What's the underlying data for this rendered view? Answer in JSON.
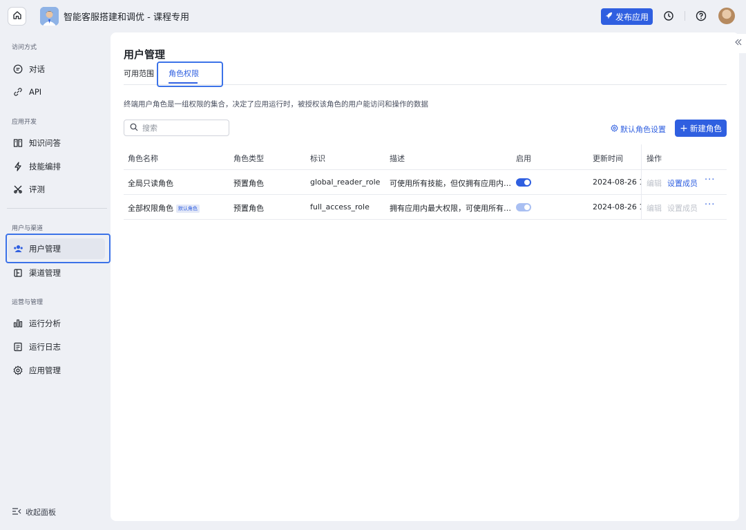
{
  "header": {
    "app_title": "智能客服搭建和调优 - 课程专用",
    "publish_label": "发布应用"
  },
  "sidebar": {
    "groups": [
      {
        "label": "访问方式",
        "items": [
          {
            "label": "对话",
            "icon": "chat-icon"
          },
          {
            "label": "API",
            "icon": "api-icon"
          }
        ]
      },
      {
        "label": "应用开发",
        "items": [
          {
            "label": "知识问答",
            "icon": "book-icon"
          },
          {
            "label": "技能编排",
            "icon": "lightning-icon"
          },
          {
            "label": "评测",
            "icon": "evaluate-icon"
          }
        ]
      },
      {
        "label": "用户与渠道",
        "items": [
          {
            "label": "用户管理",
            "icon": "users-icon"
          },
          {
            "label": "渠道管理",
            "icon": "channel-icon"
          }
        ]
      },
      {
        "label": "运营与管理",
        "items": [
          {
            "label": "运行分析",
            "icon": "bar-chart-icon"
          },
          {
            "label": "运行日志",
            "icon": "log-icon"
          },
          {
            "label": "应用管理",
            "icon": "settings-icon"
          }
        ]
      }
    ],
    "collapse_label": "收起面板"
  },
  "main": {
    "title": "用户管理",
    "tabs": [
      "可用范围",
      "角色权限"
    ],
    "description": "终端用户角色是一组权限的集合，决定了应用运行时，被授权该角色的用户能访问和操作的数据",
    "search_placeholder": "搜索",
    "default_role_label": "默认角色设置",
    "new_role_label": "新建角色",
    "table": {
      "headers": [
        "角色名称",
        "角色类型",
        "标识",
        "描述",
        "启用",
        "更新时间",
        "操作"
      ],
      "rows": [
        {
          "name": "全局只读角色",
          "tag": "",
          "type": "预置角色",
          "id": "global_reader_role",
          "desc": "可使用所有技能，但仅拥有应用内…",
          "enabled": true,
          "updated": "2024-08-26 1",
          "edit": "编辑",
          "members": "设置成员",
          "more": "···"
        },
        {
          "name": "全部权限角色",
          "tag": "默认角色",
          "type": "预置角色",
          "id": "full_access_role",
          "desc": "拥有应用内最大权限，可使用所有…",
          "enabled": true,
          "updated": "2024-08-26 1",
          "edit": "编辑",
          "members": "设置成员",
          "more": "···"
        }
      ]
    }
  },
  "colors": {
    "accent": "#2f5fe0",
    "highlight": "#3b72e8"
  }
}
